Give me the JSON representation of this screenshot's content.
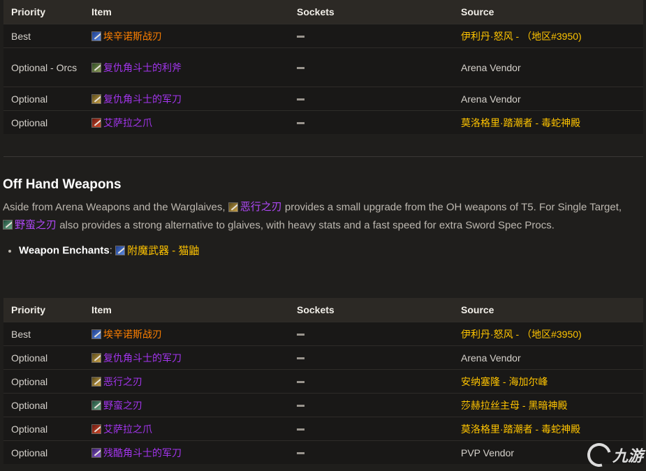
{
  "main_hand_table": {
    "headers": {
      "priority": "Priority",
      "item": "Item",
      "sockets": "Sockets",
      "source": "Source"
    },
    "rows": [
      {
        "priority": "Best",
        "item": "埃辛诺斯战刃",
        "item_quality": "legendary",
        "icon": "blue-sword-icon",
        "source": "伊利丹·怒风 - （地区#3950)",
        "source_color": "gold"
      },
      {
        "priority": "Optional - Orcs",
        "item": "复仇角斗士的利斧",
        "item_quality": "epic",
        "icon": "green-axe-icon",
        "source": "Arena Vendor",
        "source_color": "plain"
      },
      {
        "priority": "Optional",
        "item": "复仇角斗士的军刀",
        "item_quality": "epic",
        "icon": "gold-sword-icon",
        "source": "Arena Vendor",
        "source_color": "plain"
      },
      {
        "priority": "Optional",
        "item": "艾萨拉之爪",
        "item_quality": "epic",
        "icon": "red-claw-icon",
        "source": "莫洛格里·踏潮者 - 毒蛇神殿",
        "source_color": "gold"
      }
    ]
  },
  "off_hand": {
    "heading": "Off Hand Weapons",
    "para_1": "Aside from Arena Weapons and the Warglaives,",
    "link_1": "恶行之刃",
    "para_2": "provides a small upgrade from the OH weapons of T5. For Single Target,",
    "link_2": "野蛮之刃",
    "para_3": "also provides a strong alternative to glaives, with heavy stats and a fast speed for extra Sword Spec Procs.",
    "enchant_label": "Weapon Enchants",
    "enchant_colon": ":",
    "enchant_link": "附魔武器 - 猫鼬"
  },
  "off_hand_table": {
    "headers": {
      "priority": "Priority",
      "item": "Item",
      "sockets": "Sockets",
      "source": "Source"
    },
    "rows": [
      {
        "priority": "Best",
        "item": "埃辛诺斯战刃",
        "item_quality": "legendary",
        "icon": "blue-sword-icon",
        "source": "伊利丹·怒风 - （地区#3950)",
        "source_color": "gold"
      },
      {
        "priority": "Optional",
        "item": "复仇角斗士的军刀",
        "item_quality": "epic",
        "icon": "gold-sword-icon",
        "source": "Arena Vendor",
        "source_color": "plain"
      },
      {
        "priority": "Optional",
        "item": "恶行之刃",
        "item_quality": "epic",
        "icon": "gold-sword-icon",
        "source": "安纳塞隆 - 海加尔峰",
        "source_color": "gold"
      },
      {
        "priority": "Optional",
        "item": "野蛮之刃",
        "item_quality": "epic",
        "icon": "teal-sword-icon",
        "source": "莎赫拉丝主母 - 黑暗神殿",
        "source_color": "gold"
      },
      {
        "priority": "Optional",
        "item": "艾萨拉之爪",
        "item_quality": "epic",
        "icon": "red-claw-icon",
        "source": "莫洛格里·踏潮者 - 毒蛇神殿",
        "source_color": "gold"
      },
      {
        "priority": "Optional",
        "item": "残酷角斗士的军刀",
        "item_quality": "epic",
        "icon": "purple-sword-icon",
        "source": "PVP Vendor",
        "source_color": "plain"
      }
    ]
  },
  "watermark": {
    "text": "九游"
  },
  "colors": {
    "legendary": "#ff8000",
    "epic": "#a335ee",
    "source_gold": "#ffc400",
    "header_bg": "#2c2925",
    "row_bg": "#191817",
    "page_bg": "#1f1e1c"
  }
}
